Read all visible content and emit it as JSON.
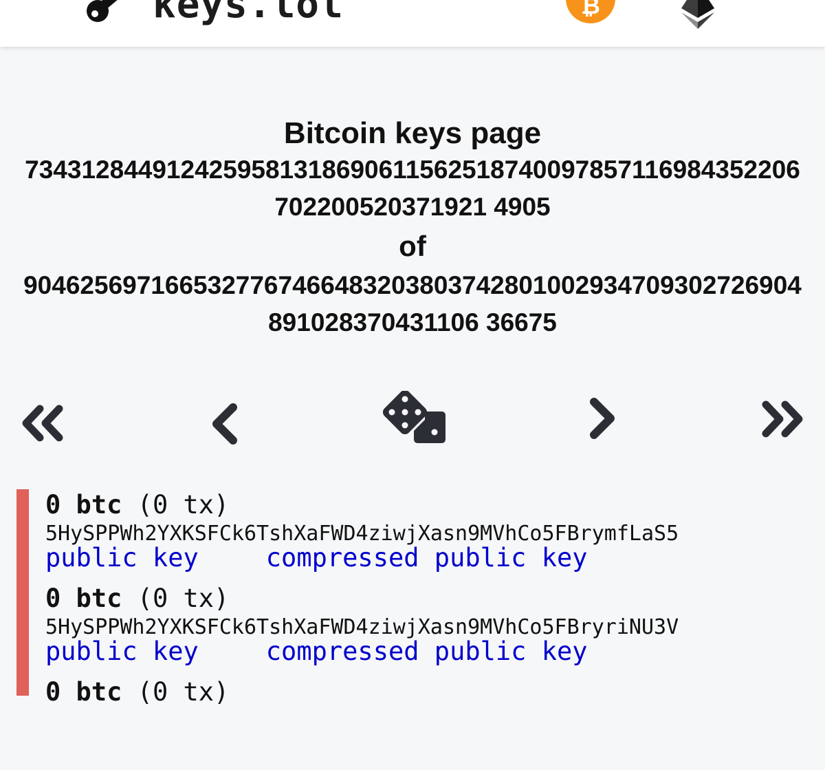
{
  "header": {
    "site_name": "keys.lol",
    "btc_glyph": "₿",
    "logo_icon": "key-icon",
    "bitcoin_icon": "bitcoin-icon",
    "ethereum_icon": "ethereum-icon",
    "brand_colors": {
      "bitcoin": "#f7931a",
      "ethereum": "#3c3c3d"
    }
  },
  "title": {
    "heading": "Bitcoin keys page",
    "current_page": "7343128449124259581318690611562518740097857116984352206702200520371921 4905",
    "of_word": "of",
    "total_pages": "9046256971665327767466483203803742801002934709302726904891028370431106 36675"
  },
  "navigation": {
    "first_icon": "double-chevron-left-icon",
    "prev_icon": "chevron-left-icon",
    "random_icon": "dice-icon",
    "next_icon": "chevron-right-icon",
    "last_icon": "double-chevron-right-icon"
  },
  "keys": [
    {
      "balance": "0 btc",
      "tx": "(0 tx)",
      "private_key": "5HySPPWh2YXKSFCk6TshXaFWD4ziwjXasn9MVhCo5FBrymfLaS5",
      "public_key_label": "public key",
      "compressed_label": "compressed public key"
    },
    {
      "balance": "0 btc",
      "tx": "(0 tx)",
      "private_key": "5HySPPWh2YXKSFCk6TshXaFWD4ziwjXasn9MVhCo5FBryriNU3V",
      "public_key_label": "public key",
      "compressed_label": "compressed public key"
    },
    {
      "balance": "0 btc",
      "tx": "(0 tx)"
    }
  ],
  "colors": {
    "status_bar": "#e0605a",
    "link": "#0000cc",
    "background": "#f6f7f9"
  }
}
